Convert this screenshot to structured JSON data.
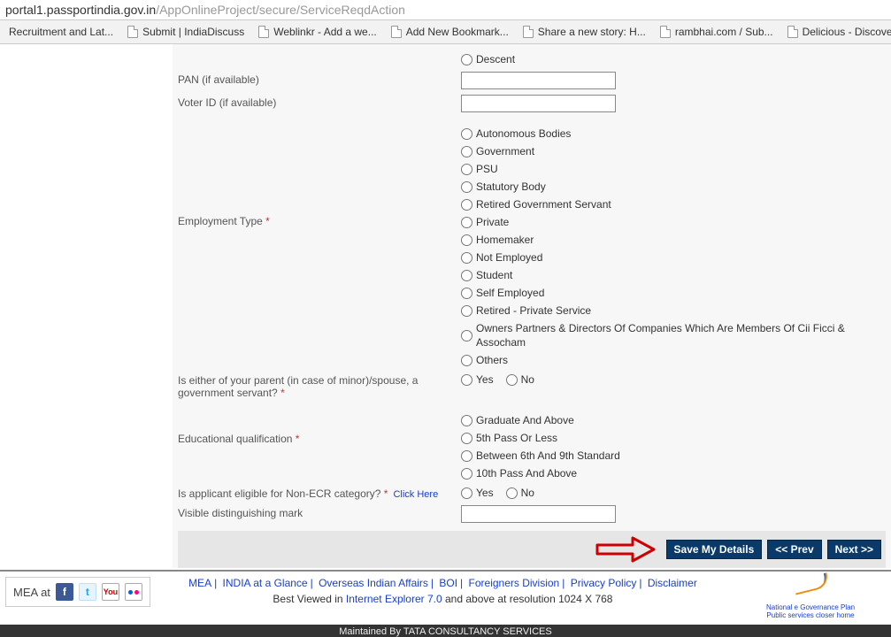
{
  "url": {
    "host": "portal1.passportindia.gov.in",
    "path": "/AppOnlineProject/secure/ServiceReqdAction"
  },
  "bookmarks": [
    "Recruitment and Lat...",
    "Submit | IndiaDiscuss",
    "Weblinkr - Add a we...",
    "Add New Bookmark...",
    "Share a new story: H...",
    "rambhai.com / Sub...",
    "Delicious - Discove"
  ],
  "form": {
    "descent_label": "Descent",
    "pan_label": "PAN (if available)",
    "voter_label": "Voter ID (if available)",
    "employment_label": "Employment Type",
    "employment_options": [
      "Autonomous Bodies",
      "Government",
      "PSU",
      "Statutory Body",
      "Retired Government Servant",
      "Private",
      "Homemaker",
      "Not Employed",
      "Student",
      "Self Employed",
      "Retired - Private Service",
      "Owners Partners & Directors Of Companies Which Are Members Of Cii Ficci & Assocham",
      "Others"
    ],
    "parent_gov_label": "Is either of your parent (in case of minor)/spouse, a government servant?",
    "yes": "Yes",
    "no": "No",
    "edu_label": "Educational qualification",
    "edu_options": [
      "Graduate And Above",
      "5th Pass Or Less",
      "Between 6th And 9th Standard",
      "10th Pass And Above"
    ],
    "non_ecr_label": "Is applicant eligible for Non-ECR category?",
    "click_here": "Click Here",
    "visible_mark_label": "Visible distinguishing mark",
    "required_marker": " *"
  },
  "buttons": {
    "save": "Save My Details",
    "prev": "<< Prev",
    "next": "Next >>"
  },
  "footer": {
    "mea_at": "MEA at",
    "links": [
      "MEA",
      "INDIA at a Glance",
      "Overseas Indian Affairs",
      "BOI",
      "Foreigners Division",
      "Privacy Policy",
      "Disclaimer"
    ],
    "viewed_prefix": "Best Viewed in ",
    "viewed_link": "Internet Explorer 7.0",
    "viewed_suffix": " and above at resolution 1024 X 768",
    "egov_line1": "National e Governance Plan",
    "egov_line2": "Public services closer home",
    "maintained": "Maintained By TATA CONSULTANCY SERVICES"
  }
}
